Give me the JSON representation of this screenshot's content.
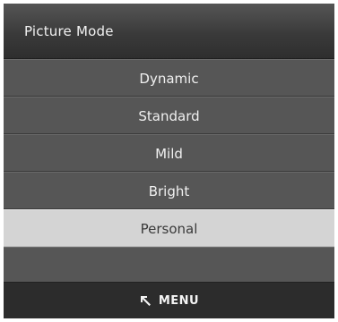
{
  "menu": {
    "title": "Picture Mode",
    "items": [
      {
        "label": "Dynamic"
      },
      {
        "label": "Standard"
      },
      {
        "label": "Mild"
      },
      {
        "label": "Bright"
      },
      {
        "label": "Personal",
        "selected": true
      }
    ]
  },
  "footer": {
    "icon": "return-icon",
    "label": "MENU"
  }
}
